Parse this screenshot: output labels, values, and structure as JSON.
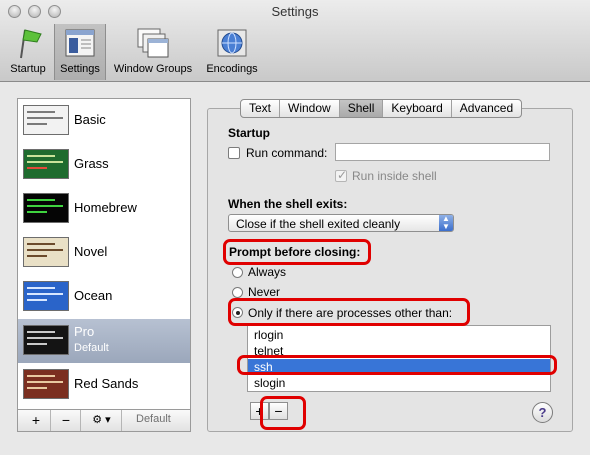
{
  "window": {
    "title": "Settings"
  },
  "toolbar": [
    {
      "label": "Startup",
      "icon": "flag-icon"
    },
    {
      "label": "Settings",
      "icon": "settings-window-icon"
    },
    {
      "label": "Window Groups",
      "icon": "window-groups-icon"
    },
    {
      "label": "Encodings",
      "icon": "encodings-globe-icon"
    }
  ],
  "profiles": [
    {
      "name": "Basic",
      "sub": "",
      "bg": "#f2f2f2",
      "bar": "#7a7a7a"
    },
    {
      "name": "Grass",
      "sub": "",
      "bg": "#1e6b2e",
      "bar": "#c9e39a"
    },
    {
      "name": "Homebrew",
      "sub": "",
      "bg": "#050505",
      "bar": "#3fd33f"
    },
    {
      "name": "Novel",
      "sub": "",
      "bg": "#e9e0c6",
      "bar": "#6b4a2b"
    },
    {
      "name": "Ocean",
      "sub": "",
      "bg": "#2a64c9",
      "bar": "#d8e7ff"
    },
    {
      "name": "Pro",
      "sub": "Default",
      "bg": "#141414",
      "bar": "#c9c9c9"
    },
    {
      "name": "Red Sands",
      "sub": "",
      "bg": "#7b2f20",
      "bar": "#e9c9a0"
    }
  ],
  "list_footer": {
    "add": "+",
    "remove": "−",
    "action": "⚙ ▾",
    "default_label": "Default"
  },
  "tabs": [
    "Text",
    "Window",
    "Shell",
    "Keyboard",
    "Advanced"
  ],
  "startup": {
    "heading": "Startup",
    "run_command_label": "Run command:",
    "run_command_value": "",
    "run_inside_shell_label": "Run inside shell"
  },
  "shell_exit": {
    "heading": "When the shell exits:",
    "selected": "Close if the shell exited cleanly"
  },
  "prompt": {
    "heading": "Prompt before closing:",
    "options": [
      "Always",
      "Never",
      "Only if there are processes other than:"
    ]
  },
  "processes": [
    "rlogin",
    "telnet",
    "ssh",
    "slogin"
  ],
  "process_buttons": {
    "add": "+",
    "remove": "−"
  },
  "help_label": "?",
  "colors": {
    "selection": "#3875d7",
    "highlight": "#e00000"
  }
}
